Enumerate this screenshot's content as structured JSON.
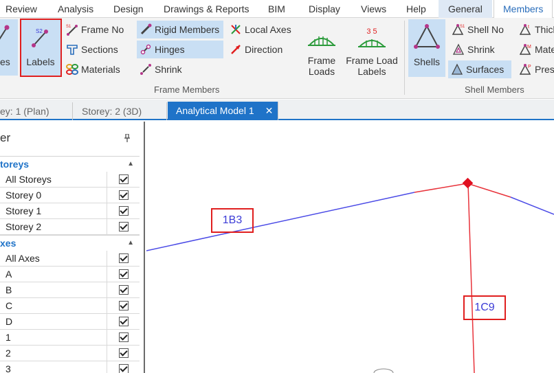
{
  "menu": {
    "tabs": [
      {
        "label": "Review"
      },
      {
        "label": "Analysis"
      },
      {
        "label": "Design"
      },
      {
        "label": "Drawings & Reports"
      },
      {
        "label": "BIM"
      },
      {
        "label": "Display"
      },
      {
        "label": "Views"
      },
      {
        "label": "Help"
      },
      {
        "label": "General"
      },
      {
        "label": "Members"
      }
    ],
    "active": "Members"
  },
  "ribbon": {
    "partial_button": "es",
    "labels_button": "Labels",
    "frame_no": "Frame No",
    "sections": "Sections",
    "materials": "Materials",
    "rigid_members": "Rigid Members",
    "hinges": "Hinges",
    "shrink": "Shrink",
    "local_axes": "Local Axes",
    "direction": "Direction",
    "frame_loads": [
      "Frame",
      "Loads"
    ],
    "frame_load_labels": [
      "Frame Load",
      "Labels"
    ],
    "frame_load_icon_text": "3  5",
    "frame_members_group": "Frame Members",
    "shells": "Shells",
    "shell_no": "Shell No",
    "shell_shrink": "Shrink",
    "surfaces": "Surfaces",
    "thick": "Thick",
    "mate": "Mate",
    "pres": "Pres",
    "shell_members_group": "Shell Members"
  },
  "doc_tabs": [
    {
      "label": "ey: 1 (Plan)"
    },
    {
      "label": "Storey: 2 (3D)"
    },
    {
      "label": "Analytical Model 1"
    }
  ],
  "doc_tab_close": "✕",
  "panel": {
    "title": "er",
    "pin": "📌",
    "categories": [
      {
        "name": "toreys",
        "rows": [
          {
            "label": "All Storeys",
            "checked": true
          },
          {
            "label": "Storey 0",
            "checked": true
          },
          {
            "label": "Storey 1",
            "checked": true
          },
          {
            "label": "Storey 2",
            "checked": true
          }
        ]
      },
      {
        "name": "xes",
        "rows": [
          {
            "label": "All Axes",
            "checked": true
          },
          {
            "label": "A",
            "checked": true
          },
          {
            "label": "B",
            "checked": true
          },
          {
            "label": "C",
            "checked": true
          },
          {
            "label": "D",
            "checked": true
          },
          {
            "label": "1",
            "checked": true
          },
          {
            "label": "2",
            "checked": true
          },
          {
            "label": "3",
            "checked": true
          }
        ]
      }
    ]
  },
  "viewport": {
    "member_labels": [
      "1B3",
      "1C9"
    ],
    "colors": {
      "beam": "#4a4ae6",
      "selected": "#e8323a",
      "node": "#e01020"
    }
  },
  "colors": {
    "accent": "#1f73c8",
    "highlight": "#c9dff4",
    "annotation": "#e01e1e"
  }
}
